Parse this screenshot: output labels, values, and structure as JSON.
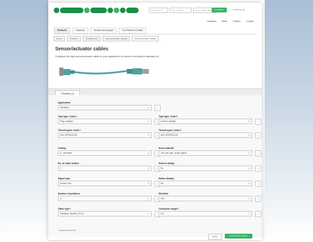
{
  "header": {
    "search_placeholders": [
      "Search term",
      "Item number",
      "Type / article name"
    ],
    "search_button": "Products",
    "top_link": "+ Products (1)"
  },
  "user_nav": [
    "Locations",
    "News",
    "Careers",
    "Contact"
  ],
  "nav_tabs": [
    "Products",
    "Solutions",
    "Service and support",
    "Our Phoenix Contact"
  ],
  "breadcrumbs": [
    "Home",
    "Products",
    "Configurators",
    "Sensor/actuator cabling",
    "Sensor/actuator cables"
  ],
  "page": {
    "title": "Sensor/actuator cables",
    "subtitle": "Configure the right sensor/actuator cable for your application to machine and system standard by:"
  },
  "tabs": [
    "Products (1)"
  ],
  "form": {
    "application": {
      "label": "Application",
      "value": "Standard"
    },
    "type_head1": {
      "label": "Type type, head 1",
      "value": "Plug, straight"
    },
    "type_head2": {
      "label": "Type type, head 2",
      "value": "Socket, straight"
    },
    "thread_head1": {
      "label": "Thread types, head 1",
      "value": "M12 SPEEDCON"
    },
    "thread_head2": {
      "label": "Thread types, head 2",
      "value": "M12 SPEEDCON"
    },
    "coding": {
      "label": "Coding",
      "value": "A - standard"
    },
    "knurl": {
      "label": "Knurl material",
      "value": "Zinc die-cast, nickel-plated"
    },
    "nr_cable_outlets": {
      "label": "No. of cable outlets",
      "value": "1"
    },
    "head_bridge": {
      "label": "Head to bridge",
      "value": "No"
    },
    "signal_type": {
      "label": "Signal type",
      "value": "Sensor bus"
    },
    "status_display": {
      "label": "Status display",
      "value": "No"
    },
    "positions": {
      "label": "Number of positions",
      "value": "4"
    },
    "shielded": {
      "label": "Shielded",
      "value": "Yes"
    },
    "cable_type": {
      "label": "Cable type",
      "value": "Standard, flexible (PVC)"
    },
    "conductor_length": {
      "label": "Conductor length",
      "value": "0.5"
    },
    "required_mark": "*"
  },
  "required_note": "* Required selection",
  "buttons": {
    "reset": "Reset",
    "next": "Continue to results"
  },
  "colors": {
    "brand_green": "#39b36a",
    "logo_green": "#1a8f4a",
    "cable_teal": "#4fa3a0"
  }
}
